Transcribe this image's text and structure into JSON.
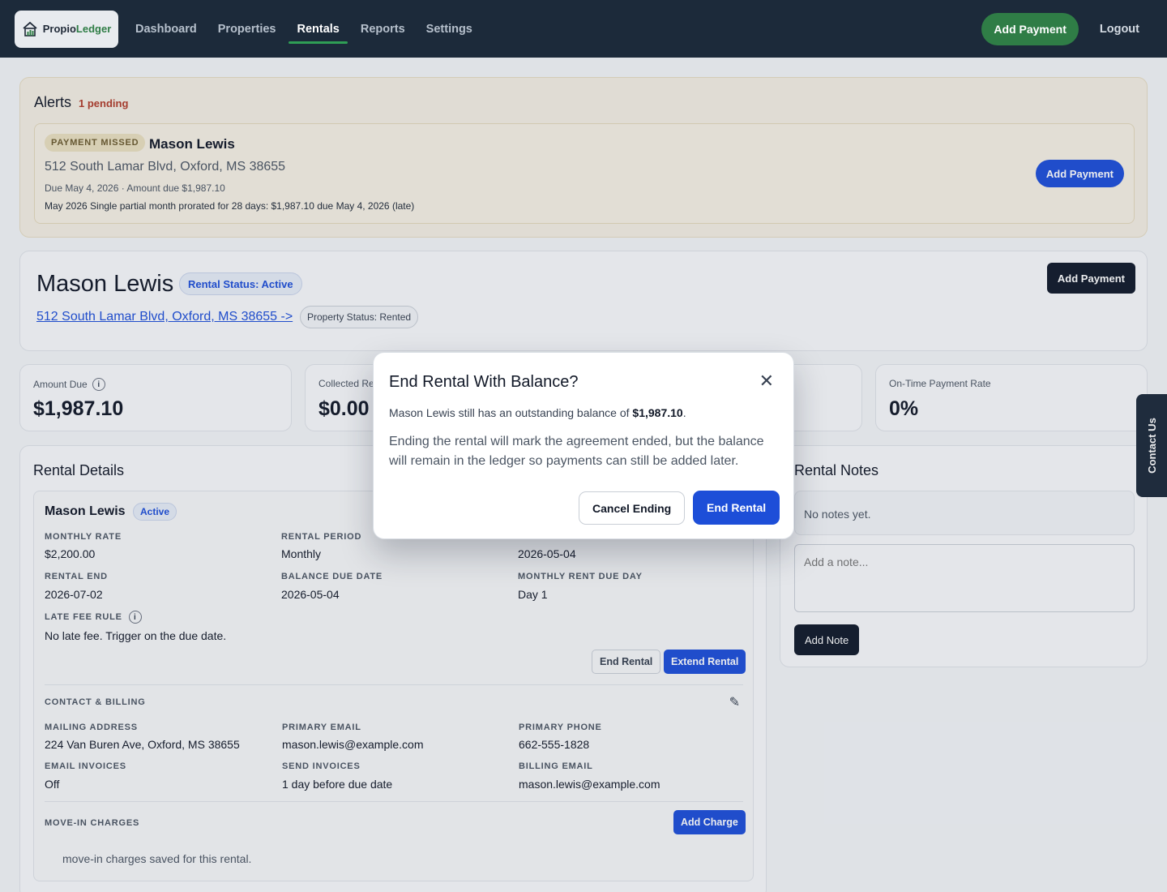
{
  "brand": {
    "name_part1": "Propio",
    "name_part2": "Ledger",
    "icon": "house-chart-icon"
  },
  "nav": {
    "items": [
      {
        "label": "Dashboard",
        "active": false
      },
      {
        "label": "Properties",
        "active": false
      },
      {
        "label": "Rentals",
        "active": true
      },
      {
        "label": "Reports",
        "active": false
      },
      {
        "label": "Settings",
        "active": false
      }
    ],
    "add_payment": "Add Payment",
    "logout": "Logout"
  },
  "alerts": {
    "title": "Alerts",
    "count": "1 pending",
    "item": {
      "badge": "PAYMENT MISSED",
      "name": "Mason Lewis",
      "address": "512 South Lamar Blvd, Oxford, MS 38655",
      "due": "Due May 4, 2026 · Amount due $1,987.10",
      "description": "May 2026 Single partial month prorated for 28 days: $1,987.10 due May 4, 2026 (late)",
      "button": "Add Payment"
    }
  },
  "tenant": {
    "name": "Mason Lewis",
    "rental_status": "Rental Status: Active",
    "address_link": "512 South Lamar Blvd, Oxford, MS 38655 ->",
    "property_status": "Property Status: Rented",
    "add_payment": "Add Payment"
  },
  "stats": [
    {
      "label": "Amount Due",
      "value": "$1,987.10"
    },
    {
      "label": "Collected Re",
      "value": "$0.00"
    },
    {
      "label": "On-Time Payment Rate",
      "value": "0%"
    }
  ],
  "details": {
    "title": "Rental Details",
    "name": "Mason Lewis",
    "status": "Active",
    "fields": {
      "monthly_rate": {
        "label": "MONTHLY RATE",
        "value": "$2,200.00"
      },
      "rental_period": {
        "label": "RENTAL PERIOD",
        "value": "Monthly"
      },
      "start_value": "2026-05-04",
      "rental_end": {
        "label": "RENTAL END",
        "value": "2026-07-02"
      },
      "balance_due": {
        "label": "BALANCE DUE DATE",
        "value": "2026-05-04"
      },
      "rent_due_day": {
        "label": "MONTHLY RENT DUE DAY",
        "value": "Day 1"
      },
      "late_fee": {
        "label": "LATE FEE RULE",
        "value": "No late fee. Trigger on the due date."
      }
    },
    "end_rental": "End Rental",
    "extend_rental": "Extend Rental",
    "contact": {
      "title": "CONTACT & BILLING",
      "mailing_address": {
        "label": "MAILING ADDRESS",
        "value": "224 Van Buren Ave, Oxford, MS 38655"
      },
      "primary_email": {
        "label": "PRIMARY EMAIL",
        "value": "mason.lewis@example.com"
      },
      "primary_phone": {
        "label": "PRIMARY PHONE",
        "value": "662-555-1828"
      },
      "email_invoices": {
        "label": "EMAIL INVOICES",
        "value": "Off"
      },
      "send_invoices": {
        "label": "SEND INVOICES",
        "value": "1 day before due date"
      },
      "billing_email": {
        "label": "BILLING EMAIL",
        "value": "mason.lewis@example.com"
      }
    },
    "move_in": {
      "title": "MOVE-IN CHARGES",
      "button": "Add Charge",
      "empty": "move-in charges saved for this rental."
    }
  },
  "notes": {
    "title": "Rental Notes",
    "empty": "No notes yet.",
    "placeholder": "Add a note...",
    "button": "Add Note"
  },
  "contact_tab": "Contact Us",
  "modal": {
    "title": "End Rental With Balance?",
    "message_prefix": "Mason Lewis still has an outstanding balance of ",
    "message_amount": "$1,987.10",
    "message_suffix": ".",
    "detail": "Ending the rental will mark the agreement ended, but the balance will remain in the ledger so payments can still be added later.",
    "cancel": "Cancel Ending",
    "confirm": "End Rental"
  }
}
